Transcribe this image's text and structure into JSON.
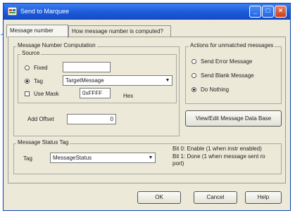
{
  "window": {
    "title": "Send to Marquee"
  },
  "tabs": [
    {
      "label": "Message number"
    },
    {
      "label": "How message number is computed?"
    }
  ],
  "computation": {
    "group_label": "Message Number Computation",
    "source_label": "Source",
    "fixed_label": "Fixed",
    "fixed_value": "",
    "tag_label": "Tag",
    "tag_value": "TargetMessage",
    "use_mask_label": "Use Mask",
    "mask_value": "0xFFFF",
    "hex_label": "Hex",
    "offset_label": "Add Offset",
    "offset_value": "0",
    "source_selected": "Tag",
    "use_mask_checked": false
  },
  "actions": {
    "group_label": "Actions for unmatched messages",
    "options": [
      {
        "label": "Send Error Message",
        "selected": false
      },
      {
        "label": "Send Blank Message",
        "selected": false
      },
      {
        "label": "Do Nothing",
        "selected": true
      }
    ],
    "database_button": "View/Edit Message Data Base"
  },
  "status": {
    "group_label": "Message Status Tag",
    "tag_label": "Tag",
    "tag_value": "MessageStatus",
    "bit0_text": "Bit 0: Enable (1 when instr enabled)",
    "bit1_text": "Bit 1: Done (1 when message sent ro port)"
  },
  "buttons": {
    "ok": "OK",
    "cancel": "Cancel",
    "help": "Help"
  },
  "colors": {
    "titlebar": "#1c5ad8",
    "callout": "#1e8fe0"
  }
}
